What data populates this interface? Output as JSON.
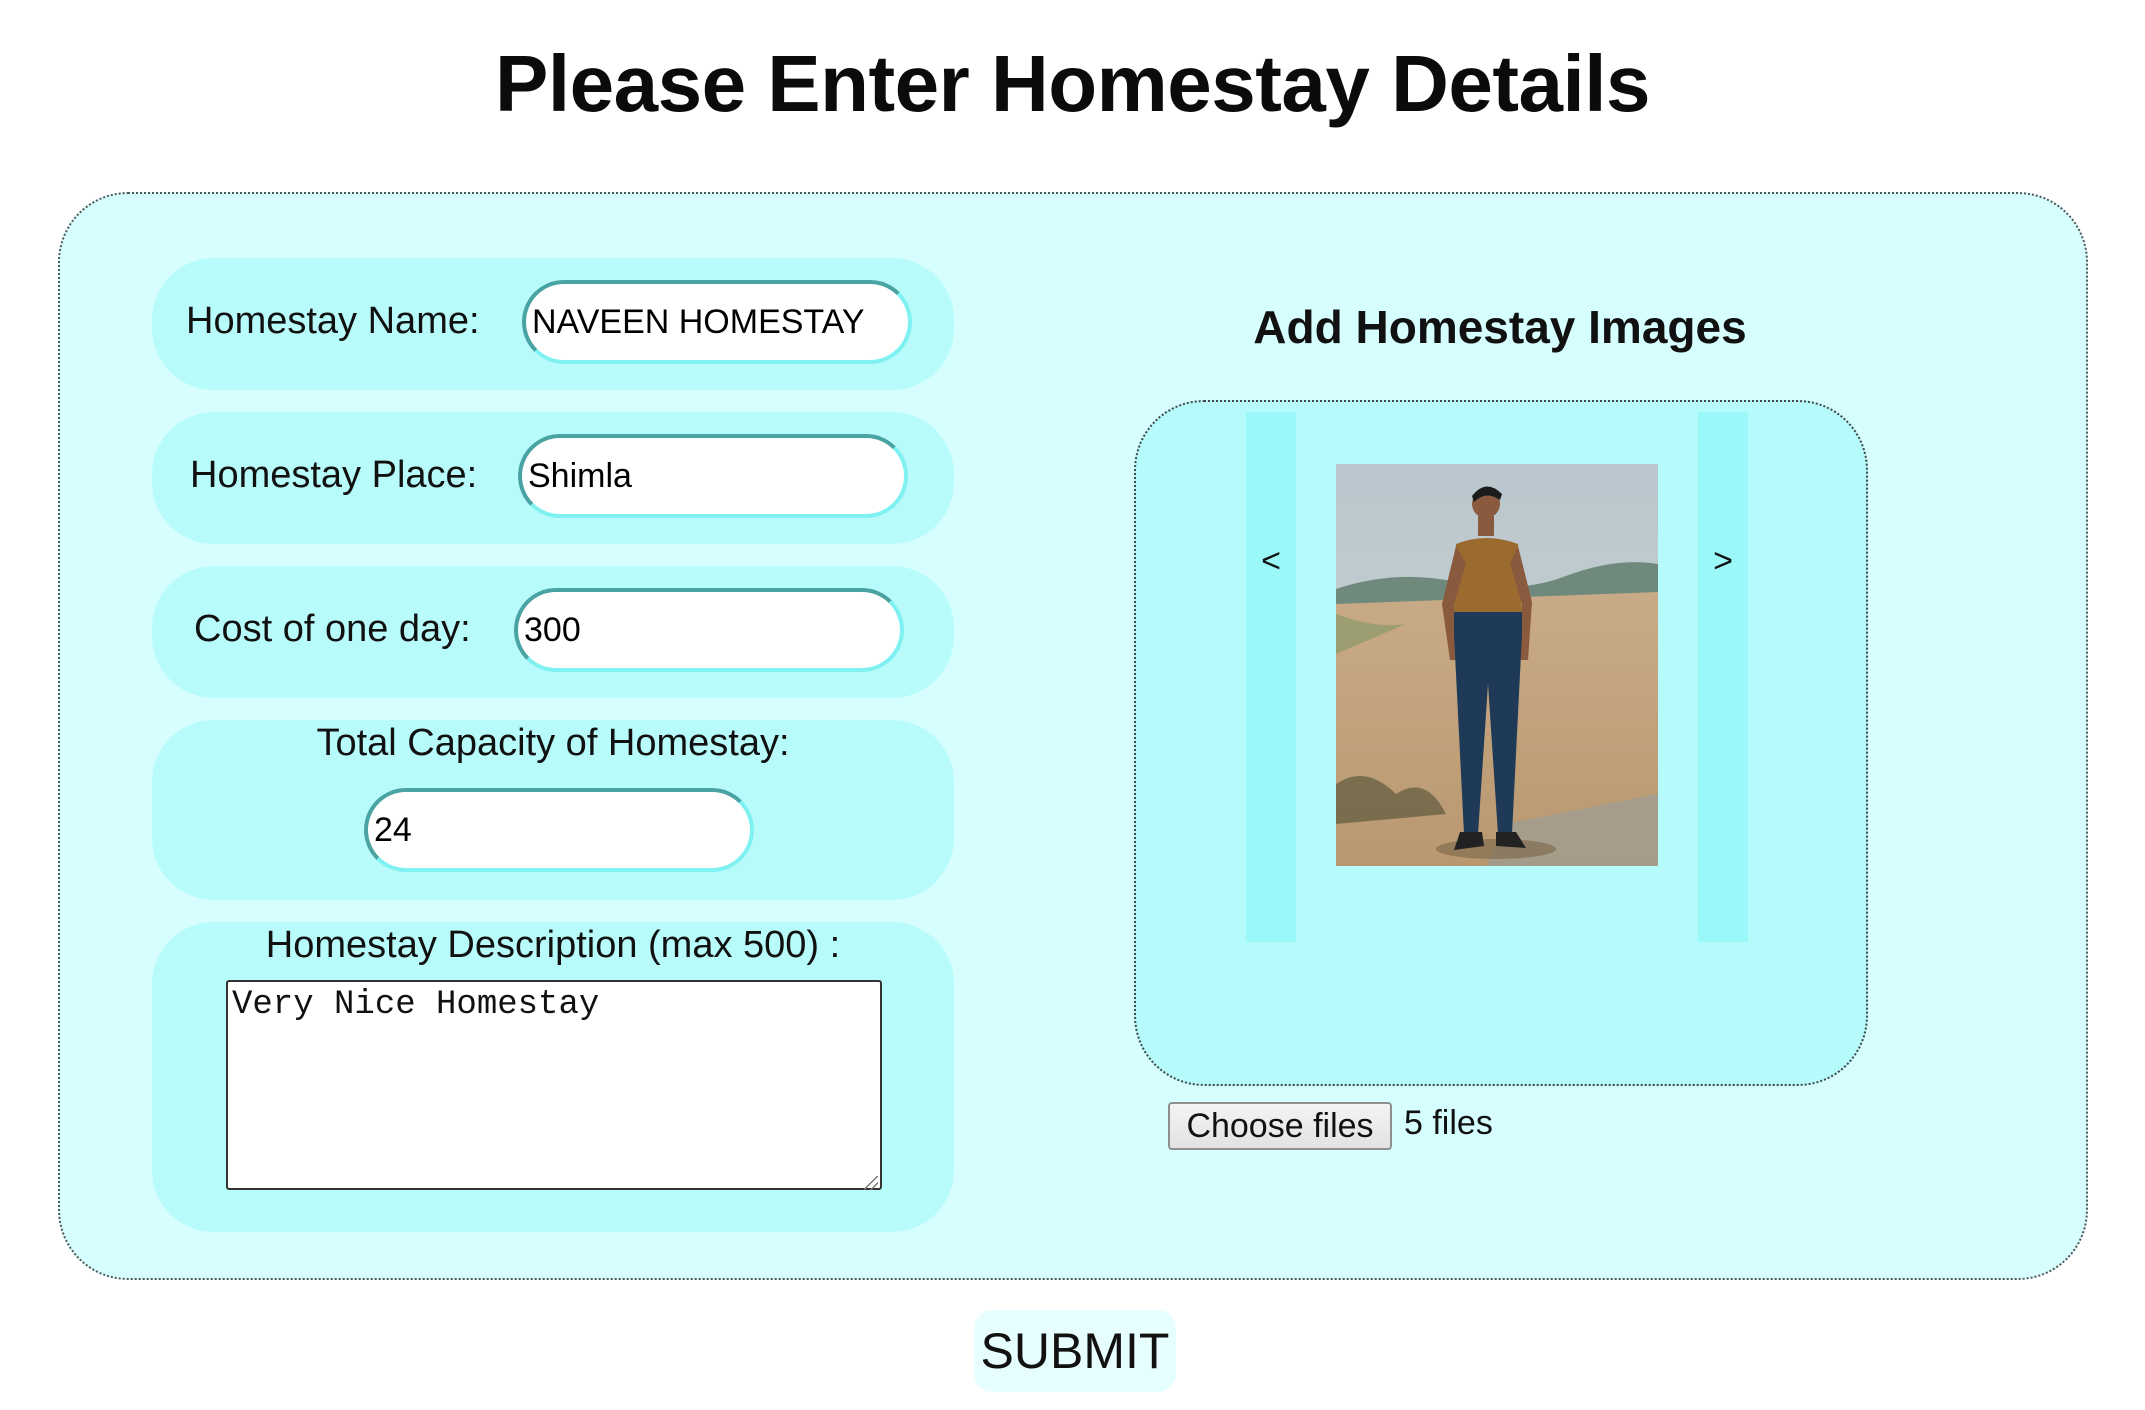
{
  "page": {
    "title": "Please Enter Homestay Details"
  },
  "form": {
    "name_label": "Homestay Name:",
    "name_value": "NAVEEN HOMESTAY",
    "place_label": "Homestay Place:",
    "place_value": "Shimla",
    "cost_label": "Cost of one day:",
    "cost_value": "300",
    "capacity_label": "Total Capacity of Homestay:",
    "capacity_value": "24",
    "description_label": "Homestay Description (max 500) :",
    "description_value": "Very Nice Homestay"
  },
  "images": {
    "heading": "Add Homestay Images",
    "prev_label": "<",
    "next_label": ">",
    "choose_label": "Choose files",
    "file_count": "5 files"
  },
  "submit_label": "SUBMIT",
  "colors": {
    "panel_bg": "#d6fefe",
    "pill_bg": "#b8fbfb",
    "gallery_bg": "#b6fbfb",
    "nav_bg": "#9bf8f8",
    "input_border": "#7ff1f1"
  }
}
